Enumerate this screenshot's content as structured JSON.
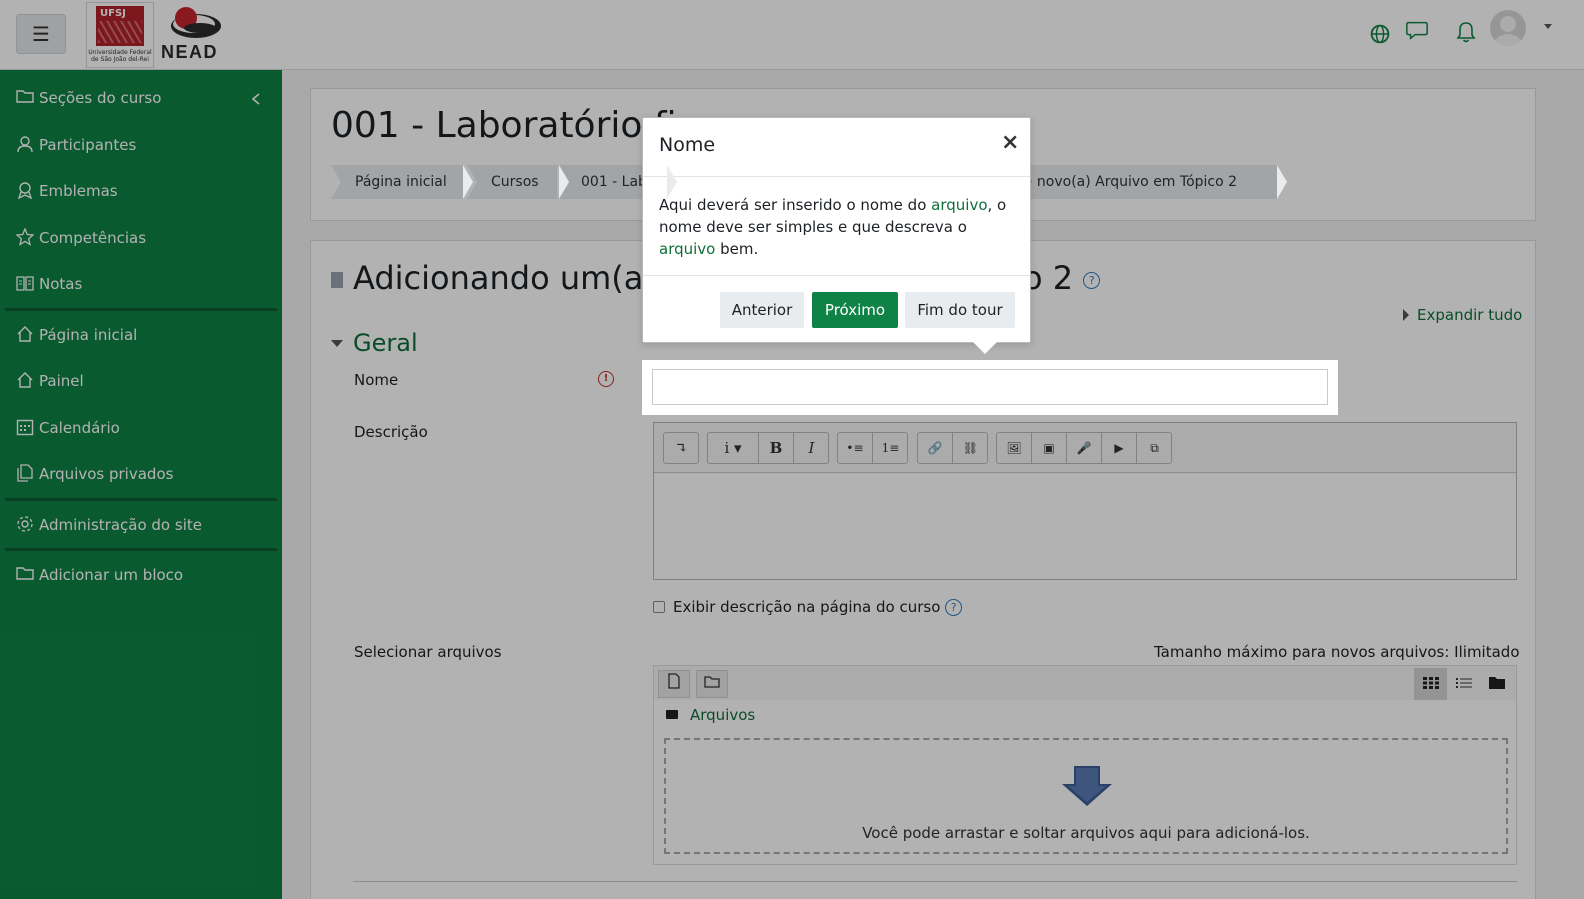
{
  "navbar": {
    "menu_icon": "hamburger-icon",
    "logo_ufsj": {
      "mark_text": "UFSJ",
      "caption": "Universidade Federal de São João del-Rei"
    },
    "logo_nead": {
      "text": "NEAD"
    },
    "icons": [
      "globe-icon",
      "chat-icon",
      "bell-icon",
      "avatar",
      "caret-down-icon"
    ]
  },
  "sidebar": {
    "items": [
      {
        "label": "Seções do curso",
        "icon": "folder-icon"
      },
      {
        "label": "Participantes",
        "icon": "users-icon"
      },
      {
        "label": "Emblemas",
        "icon": "badge-icon"
      },
      {
        "label": "Competências",
        "icon": "star-icon"
      },
      {
        "label": "Notas",
        "icon": "grades-icon"
      },
      {
        "label": "Página inicial",
        "icon": "home-icon"
      },
      {
        "label": "Painel",
        "icon": "dashboard-icon"
      },
      {
        "label": "Calendário",
        "icon": "calendar-icon"
      },
      {
        "label": "Arquivos privados",
        "icon": "files-icon"
      },
      {
        "label": "Administração do site",
        "icon": "gear-icon"
      },
      {
        "label": "Adicionar um bloco",
        "icon": "folder-icon"
      }
    ]
  },
  "header": {
    "title": "001 - Laboratório",
    "title_tail": "fi",
    "breadcrumbs": [
      "Página inicial",
      "Cursos",
      "001 - Lab",
      ") novo(a) Arquivo em Tópico 2"
    ]
  },
  "form": {
    "heading_left": "Adicionando um(a)",
    "heading_right": "o 2",
    "expand_all": "Expandir tudo",
    "section": "Geral",
    "name_label": "Nome",
    "name_value": "",
    "description_label": "Descrição",
    "show_description": "Exibir descrição na página do curso",
    "files_label": "Selecionar arquivos",
    "max_size": "Tamanho máximo para novos arquivos: Ilimitado",
    "files_folder": "Arquivos",
    "drop_text": "Você pode arrastar e soltar arquivos aqui para adicioná-los."
  },
  "editor_toolbar": {
    "groups": [
      [
        "↴"
      ],
      [
        "i ▾",
        "B",
        "I"
      ],
      [
        "•≡",
        "1≡"
      ],
      [
        "🔗",
        "⛓"
      ],
      [
        "🖼",
        "▣",
        "🎤",
        "▶",
        "⧉"
      ]
    ]
  },
  "tour": {
    "title": "Nome",
    "close": "×",
    "body_1": "Aqui deverá ser inserido o nome do ",
    "body_link_1": "arquivo",
    "body_2": ", o nome deve ser simples e que descreva o ",
    "body_link_2": "arquivo",
    "body_3": " bem.",
    "btn_prev": "Anterior",
    "btn_next": "Próximo",
    "btn_end": "Fim do tour"
  },
  "colors": {
    "brand_green": "#0f8245",
    "link_green": "#0f6e3a",
    "sidebar_divider": "#0a5b30",
    "ufsj_red": "#b3222b"
  }
}
